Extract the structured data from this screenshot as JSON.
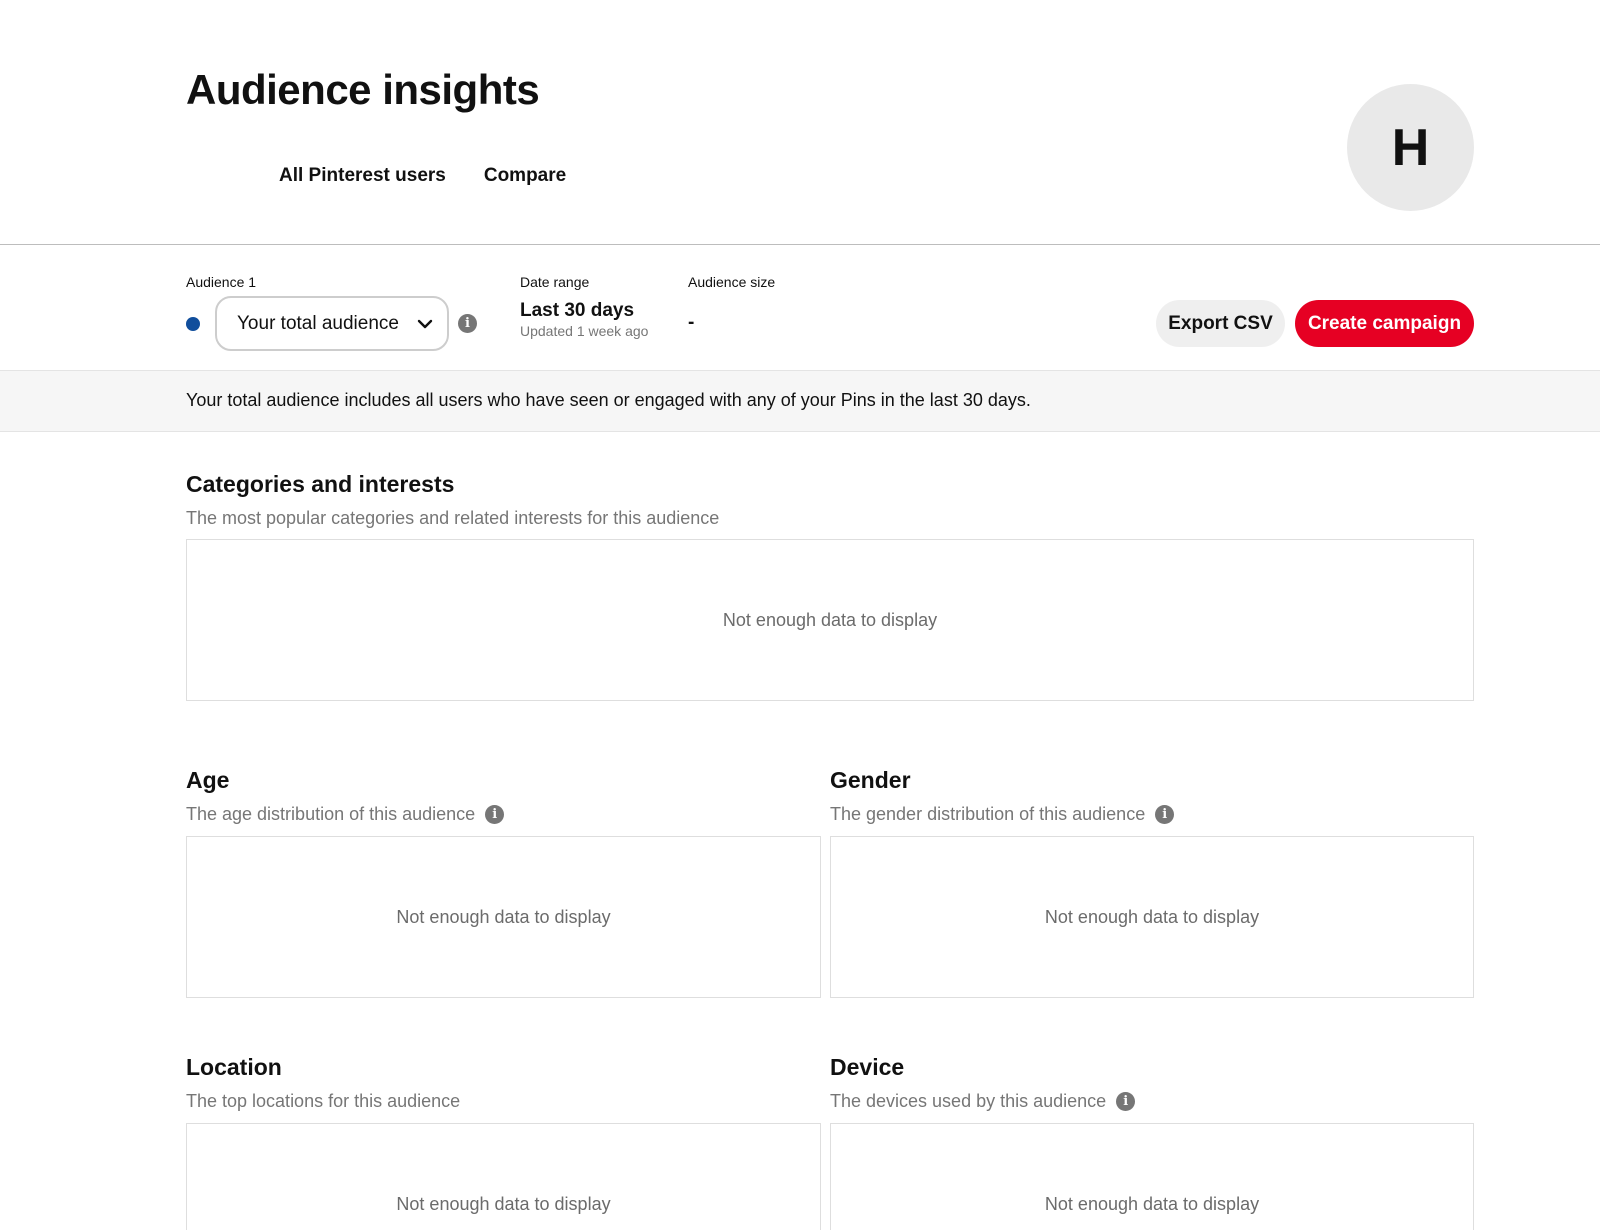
{
  "header": {
    "title": "Audience insights",
    "tabs": [
      "All Pinterest users",
      "Compare"
    ],
    "avatar_initial": "H"
  },
  "filters": {
    "audience_label": "Audience 1",
    "audience_value": "Your total audience",
    "audience_dot_color": "#104e9c",
    "date_label": "Date range",
    "date_value": "Last 30 days",
    "date_updated": "Updated 1 week ago",
    "size_label": "Audience size",
    "size_value": "-",
    "export_label": "Export CSV",
    "create_label": "Create campaign",
    "create_color": "#e60023"
  },
  "info_strip": "Your total audience includes all users who have seen or engaged with any of your Pins in the last 30 days.",
  "sections": {
    "categories": {
      "title": "Categories and interests",
      "subtitle": "The most popular categories and related interests for this audience",
      "empty": "Not enough data to display"
    },
    "age": {
      "title": "Age",
      "subtitle": "The age distribution of this audience",
      "empty": "Not enough data to display"
    },
    "gender": {
      "title": "Gender",
      "subtitle": "The gender distribution of this audience",
      "empty": "Not enough data to display"
    },
    "location": {
      "title": "Location",
      "subtitle": "The top locations for this audience",
      "empty": "Not enough data to display"
    },
    "device": {
      "title": "Device",
      "subtitle": "The devices used by this audience",
      "empty": "Not enough data to display"
    }
  },
  "icons": {
    "info": "info-icon",
    "dropdown": "chevron-down-icon"
  }
}
